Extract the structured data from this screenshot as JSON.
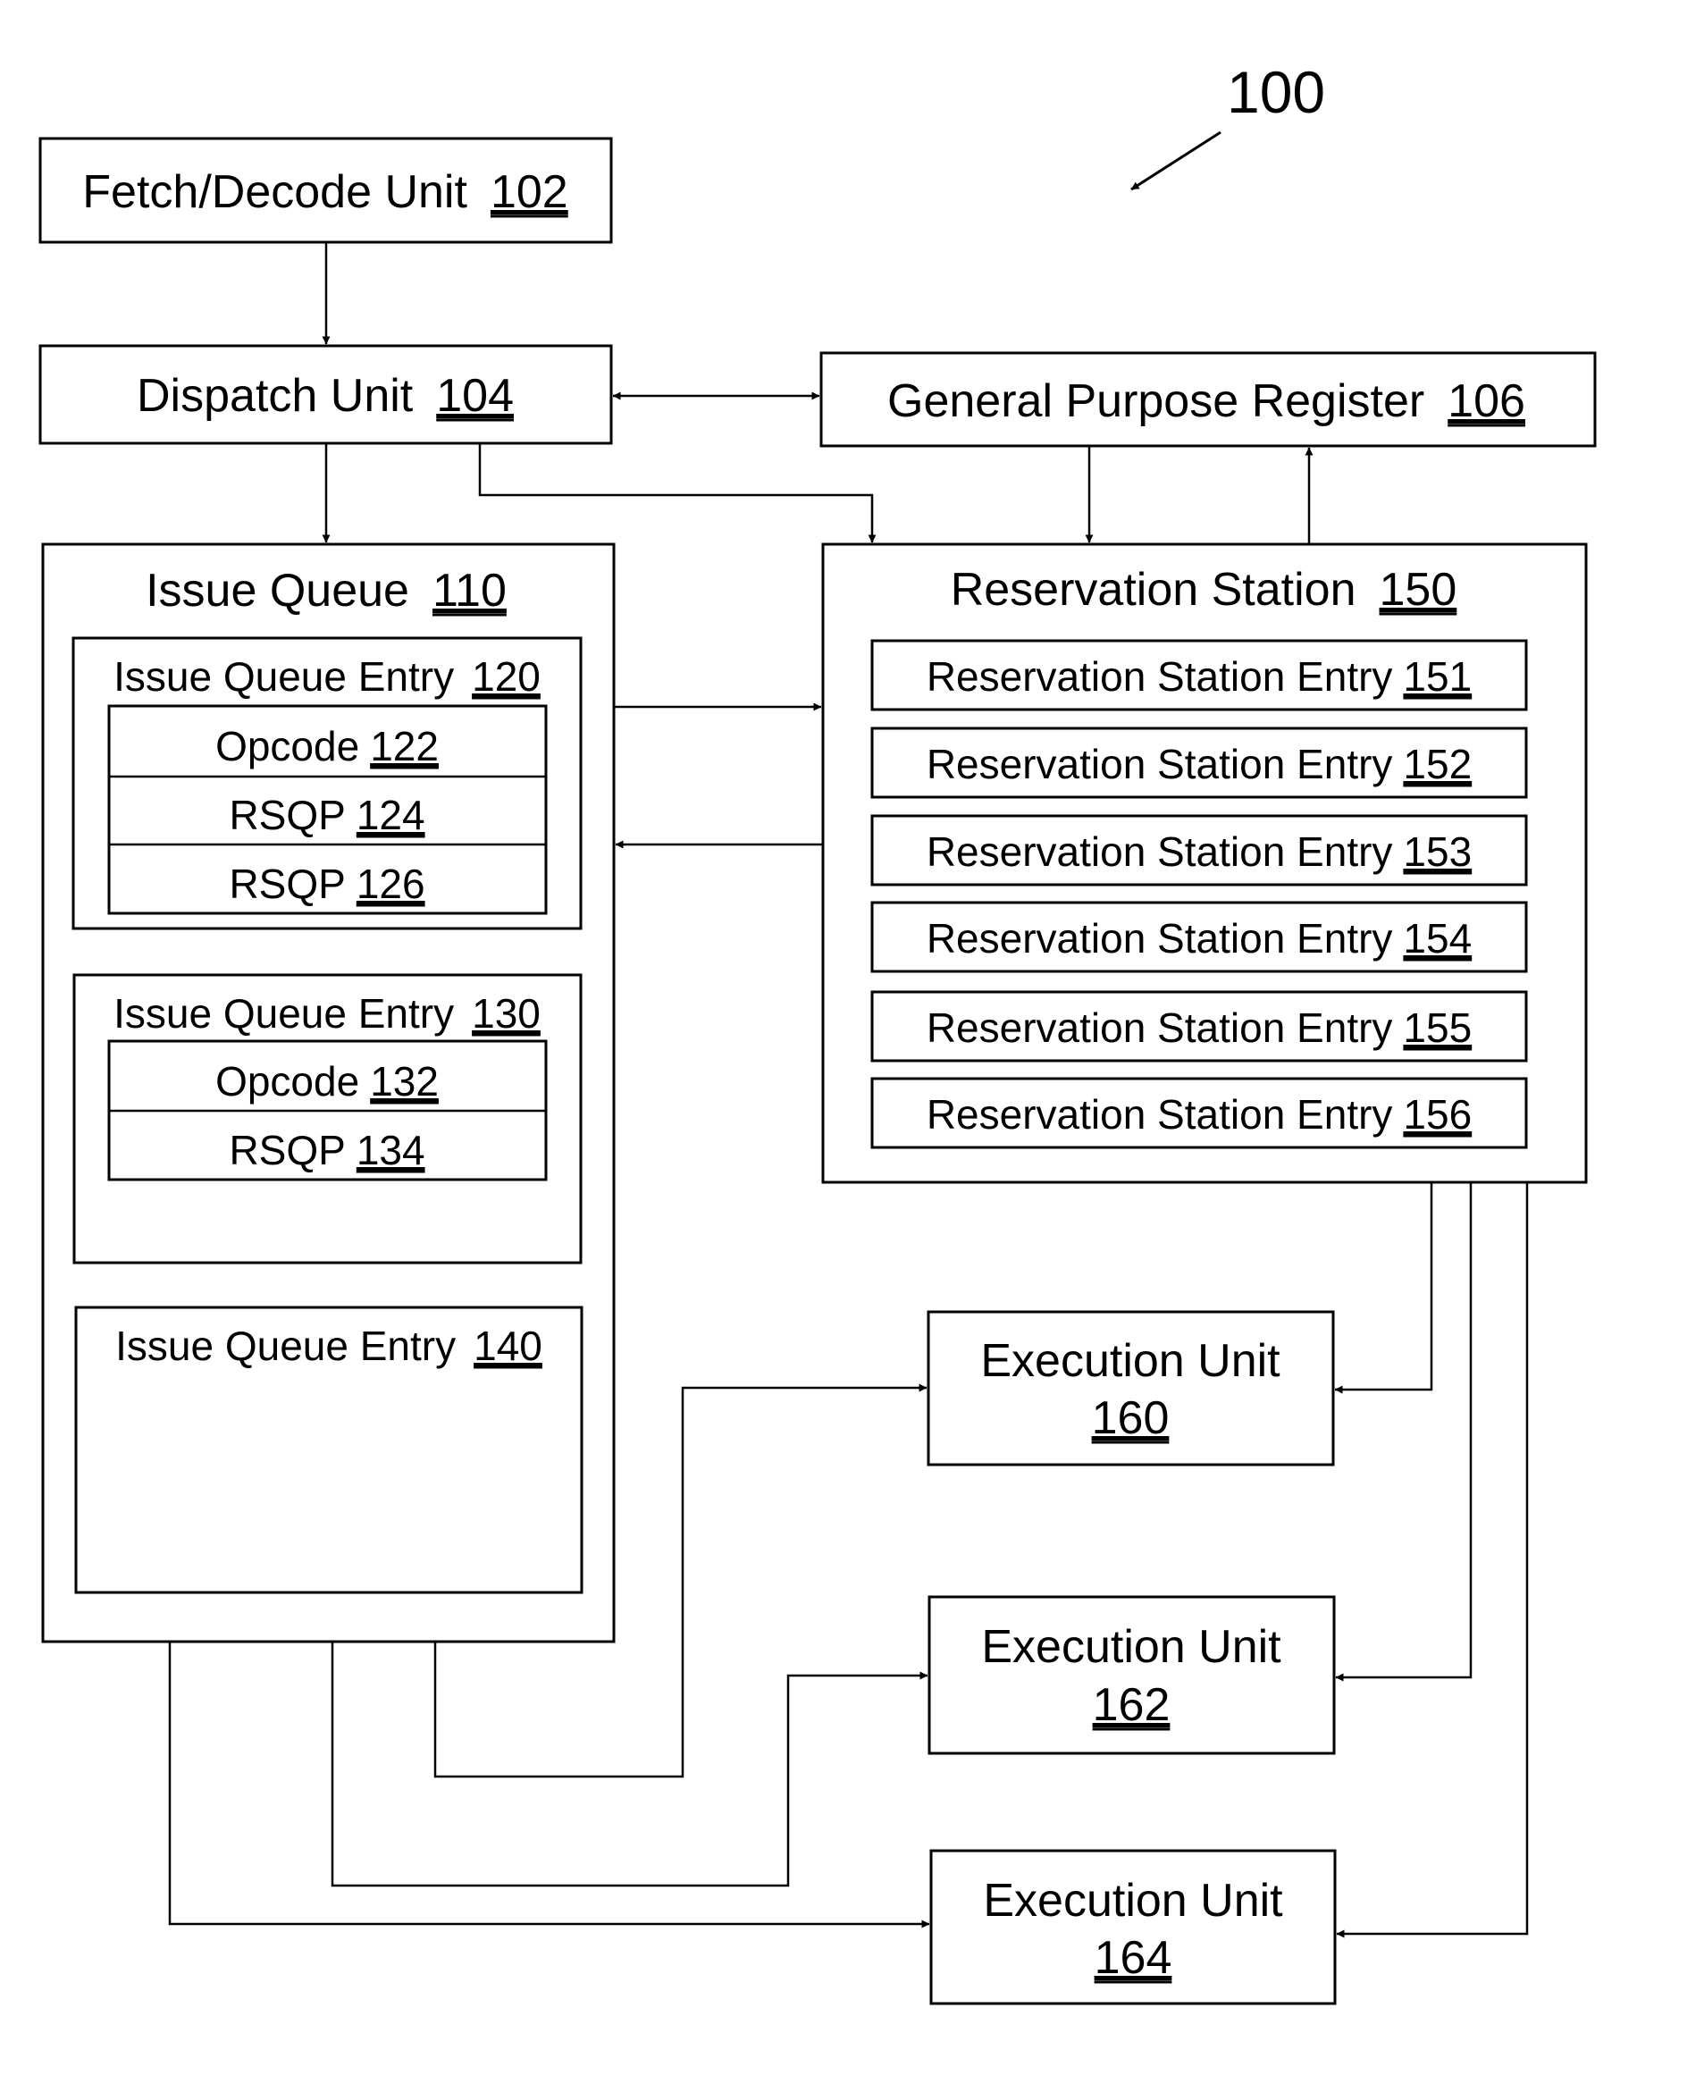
{
  "figure": {
    "reference": "100",
    "colors": {
      "line": "#000000",
      "background": "#ffffff"
    }
  },
  "units": {
    "fetch_decode": {
      "label": "Fetch/Decode Unit",
      "ref": "102"
    },
    "dispatch": {
      "label": "Dispatch Unit",
      "ref": "104"
    },
    "gpr": {
      "label": "General Purpose Register",
      "ref": "106"
    },
    "issue_queue": {
      "label": "Issue Queue",
      "ref": "110",
      "entries": [
        {
          "label": "Issue Queue Entry",
          "ref": "120",
          "fields": [
            {
              "label": "Opcode",
              "ref": "122"
            },
            {
              "label": "RSQP",
              "ref": "124"
            },
            {
              "label": "RSQP",
              "ref": "126"
            }
          ]
        },
        {
          "label": "Issue Queue Entry",
          "ref": "130",
          "fields": [
            {
              "label": "Opcode",
              "ref": "132"
            },
            {
              "label": "RSQP",
              "ref": "134"
            }
          ]
        },
        {
          "label": "Issue Queue Entry",
          "ref": "140",
          "fields": []
        }
      ]
    },
    "reservation_station": {
      "label": "Reservation Station",
      "ref": "150",
      "entries": [
        {
          "label": "Reservation Station Entry",
          "ref": "151"
        },
        {
          "label": "Reservation Station Entry",
          "ref": "152"
        },
        {
          "label": "Reservation Station Entry",
          "ref": "153"
        },
        {
          "label": "Reservation Station Entry",
          "ref": "154"
        },
        {
          "label": "Reservation Station Entry",
          "ref": "155"
        },
        {
          "label": "Reservation Station Entry",
          "ref": "156"
        }
      ]
    },
    "execution_units": [
      {
        "label": "Execution Unit",
        "ref": "160"
      },
      {
        "label": "Execution Unit",
        "ref": "162"
      },
      {
        "label": "Execution Unit",
        "ref": "164"
      }
    ]
  },
  "connections": [
    {
      "from": "Fetch/Decode Unit 102",
      "to": "Dispatch Unit 104",
      "type": "arrow"
    },
    {
      "from": "Dispatch Unit 104",
      "to": "General Purpose Register 106",
      "type": "bidirectional"
    },
    {
      "from": "Dispatch Unit 104",
      "to": "Issue Queue 110",
      "type": "arrow"
    },
    {
      "from": "Dispatch Unit 104",
      "to": "Reservation Station 150",
      "type": "arrow"
    },
    {
      "from": "General Purpose Register 106",
      "to": "Reservation Station 150",
      "type": "arrow"
    },
    {
      "from": "Reservation Station 150",
      "to": "General Purpose Register 106",
      "type": "arrow"
    },
    {
      "from": "Issue Queue 110",
      "to": "Reservation Station 150",
      "type": "arrow"
    },
    {
      "from": "Reservation Station 150",
      "to": "Issue Queue 110",
      "type": "arrow"
    },
    {
      "from": "Issue Queue 110",
      "to": "Execution Unit 160",
      "type": "arrow"
    },
    {
      "from": "Issue Queue 110",
      "to": "Execution Unit 162",
      "type": "arrow"
    },
    {
      "from": "Issue Queue 110",
      "to": "Execution Unit 164",
      "type": "arrow"
    },
    {
      "from": "Reservation Station 150",
      "to": "Execution Unit 160",
      "type": "arrow"
    },
    {
      "from": "Reservation Station 150",
      "to": "Execution Unit 162",
      "type": "arrow"
    },
    {
      "from": "Reservation Station 150",
      "to": "Execution Unit 164",
      "type": "arrow"
    }
  ]
}
